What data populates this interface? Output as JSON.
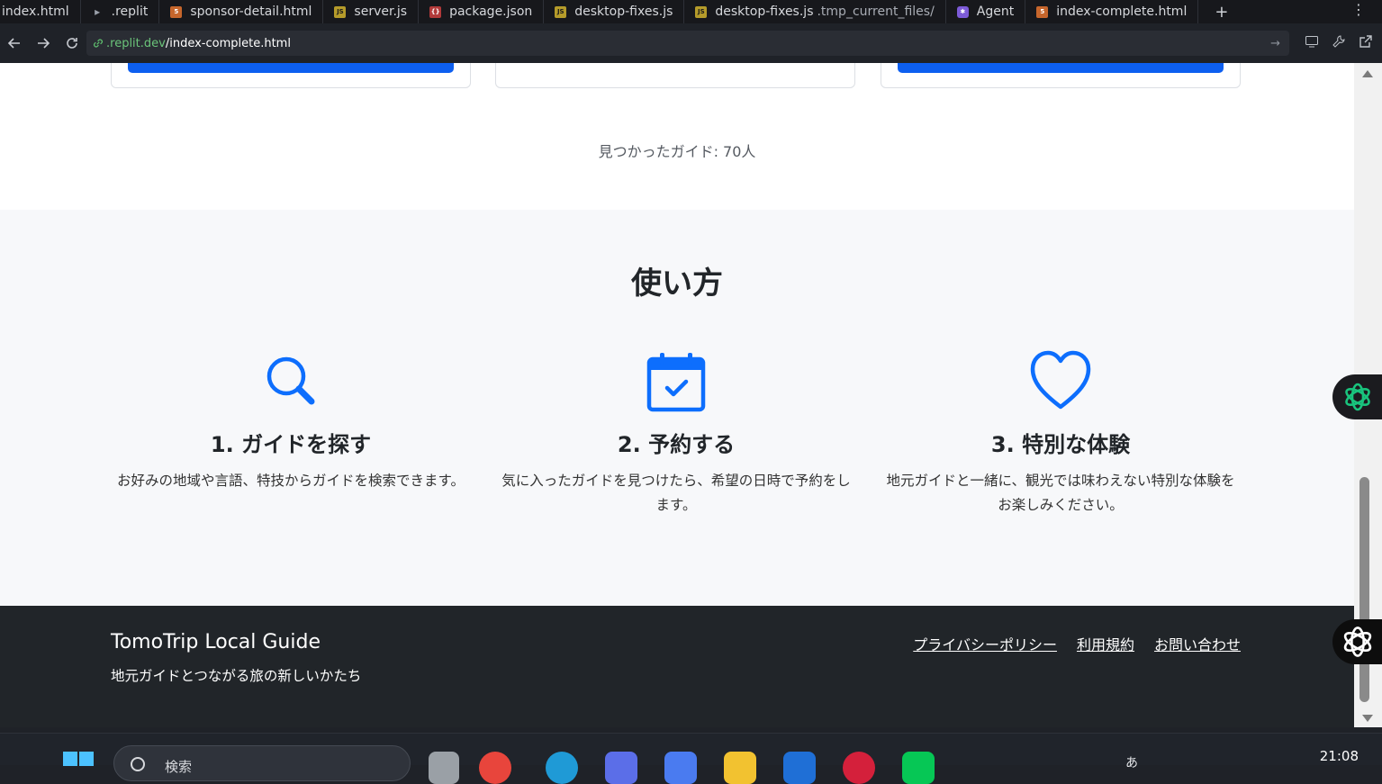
{
  "browser": {
    "tabs": [
      {
        "label": "index.html",
        "icon": "html-file-icon"
      },
      {
        "label": ".replit",
        "icon": "replit-config-icon"
      },
      {
        "label": "sponsor-detail.html",
        "icon": "html-file-icon"
      },
      {
        "label": "server.js",
        "icon": "js-file-icon"
      },
      {
        "label": "package.json",
        "icon": "json-file-icon"
      },
      {
        "label": "desktop-fixes.js",
        "icon": "js-file-icon"
      },
      {
        "label": "desktop-fixes.js",
        "sub": ".tmp_current_files/",
        "icon": "js-file-icon"
      },
      {
        "label": "Agent",
        "icon": "agent-icon"
      },
      {
        "label": "index-complete.html",
        "icon": "html-file-icon"
      }
    ],
    "new_tab": "+",
    "more": "⋮",
    "url_host": ".replit.dev",
    "url_path": "/index-complete.html"
  },
  "page": {
    "found_text": "見つかったガイド: 70人",
    "howto_title": "使い方",
    "steps": [
      {
        "title": "1. ガイドを探す",
        "desc": "お好みの地域や言語、特技からガイドを検索できます。",
        "icon": "search-icon"
      },
      {
        "title": "2. 予約する",
        "desc": "気に入ったガイドを見つけたら、希望の日時で予約をします。",
        "icon": "calendar-check-icon"
      },
      {
        "title": "3. 特別な体験",
        "desc": "地元ガイドと一緒に、観光では味わえない特別な体験をお楽しみください。",
        "icon": "heart-icon"
      }
    ],
    "footer": {
      "brand": "TomoTrip Local Guide",
      "tagline": "地元ガイドとつながる旅の新しいかたち",
      "links": [
        "プライバシーポリシー",
        "利用規約",
        "お問い合わせ"
      ]
    }
  },
  "taskbar": {
    "search_placeholder": "検索",
    "clock": "21:08",
    "tray_ime": "あ"
  },
  "colors": {
    "accent": "#0d6efd",
    "footer_bg": "#212529",
    "section_bg": "#f7f8fa"
  }
}
